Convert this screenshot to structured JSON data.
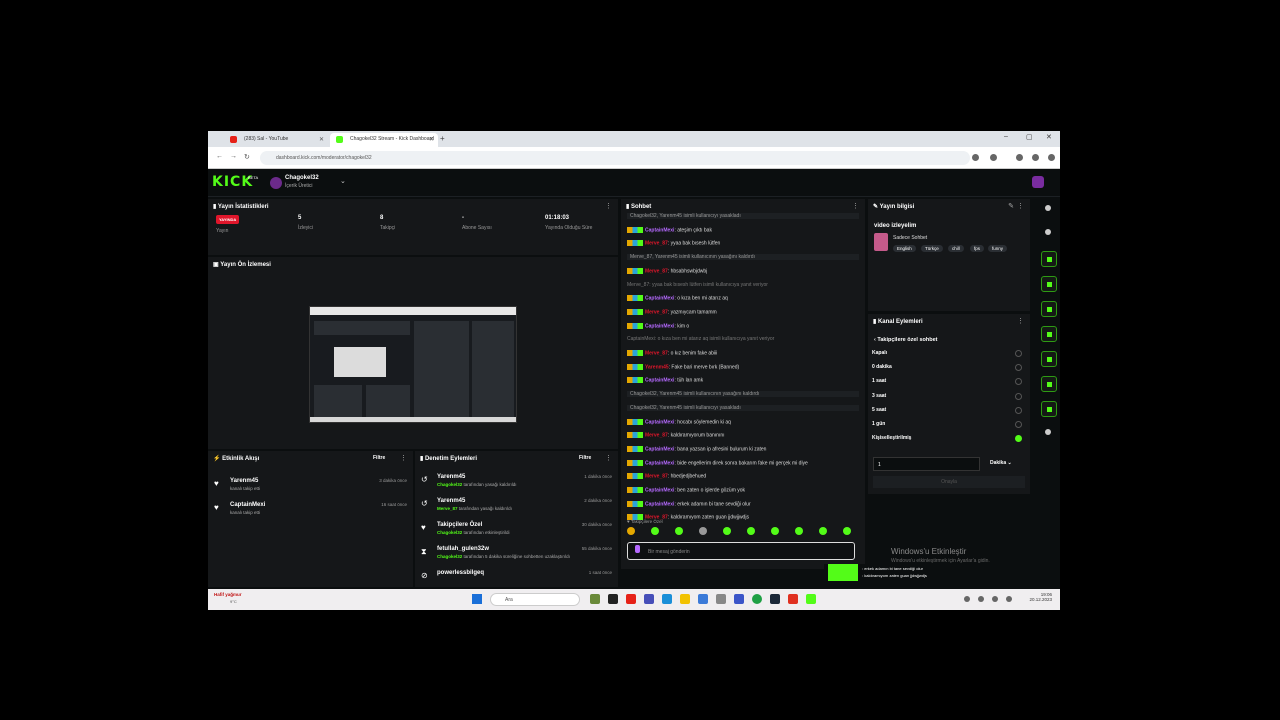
{
  "browser": {
    "tabs": [
      {
        "title": "(283) Sal - YouTube"
      },
      {
        "title": "Chagokel32 Stream - Kick Dashboard"
      }
    ],
    "url": "dashboard.kick.com/moderator/chagokel32"
  },
  "header": {
    "logo": "KICK",
    "beta": "BETA",
    "channel": "Chagokel32",
    "role": "İçerik Üretici"
  },
  "stats": {
    "title": "Yayın İstatistikleri",
    "live_badge": "YAYINDA",
    "items": [
      {
        "label": "Yayın",
        "value": ""
      },
      {
        "label": "İzleyici",
        "value": "5"
      },
      {
        "label": "Takipçi",
        "value": "8"
      },
      {
        "label": "Abone Sayısı",
        "value": "-"
      },
      {
        "label": "Yayında Olduğu Süre",
        "value": "01:18:03"
      }
    ]
  },
  "preview": {
    "title": "Yayın Ön İzlemesi"
  },
  "activity": {
    "title": "Etkinlik Akışı",
    "filter": "Filtre",
    "items": [
      {
        "name": "Yarenm45",
        "desc": "kanalı takip etti",
        "time": "3 dakika önce"
      },
      {
        "name": "CaptainMexi",
        "desc": "kanalı takip etti",
        "time": "16 saat önce"
      }
    ]
  },
  "moderation": {
    "title": "Denetim Eylemleri",
    "filter": "Filtre",
    "items": [
      {
        "name": "Yarenm45",
        "actor": "Chagokel32",
        "desc": "tarafından yasağı kaldırıldı",
        "time": "1 dakika önce"
      },
      {
        "name": "Yarenm45",
        "actor": "Merve_87",
        "desc": "tarafından yasağı kaldırıldı",
        "time": "2 dakika önce"
      },
      {
        "name": "Takipçilere Özel",
        "actor": "Chagokel32",
        "desc": "tarafından etkinleştirildi",
        "time": "30 dakika önce"
      },
      {
        "name": "fetullah_gulen32w",
        "actor": "Chagokel32",
        "desc": "tarafından 5 dakika süreliğine sohbetten uzaklaştırıldı",
        "time": "55 dakika önce"
      },
      {
        "name": "powerlessbilgeq",
        "actor": "",
        "desc": "",
        "time": "1 saat önce"
      }
    ]
  },
  "chat": {
    "title": "Sohbet",
    "followers_only": "Takipçilere Özel",
    "placeholder": "Bir mesaj gönderin",
    "messages": [
      {
        "type": "sys",
        "text": "Chagokel32, Yarenm45 isimli kullanıcıyı yasakladı"
      },
      {
        "type": "msg",
        "user": "CaptainMexi",
        "color": "cap",
        "text": ": ateşim çıktı bak"
      },
      {
        "type": "msg",
        "user": "Merve_87",
        "color": "mer",
        "text": ": yyaa bak bısesh lütfen"
      },
      {
        "type": "sys",
        "text": "Merve_87, Yarenm45 isimli kullanıcının yasağını kaldırdı"
      },
      {
        "type": "msg",
        "user": "Merve_87",
        "color": "mer",
        "text": ": hbsabhswbjdwbj"
      },
      {
        "type": "note",
        "text": "Merve_87: yyaa bak bısesh lütfen isimli kullanıcıya yanıt veriyor"
      },
      {
        "type": "msg",
        "user": "CaptainMexi",
        "color": "cap",
        "text": ": o kıza ben mi atarız aq"
      },
      {
        "type": "msg",
        "user": "Merve_87",
        "color": "mer",
        "text": ": yazmıycam tamamm"
      },
      {
        "type": "msg",
        "user": "CaptainMexi",
        "color": "cap",
        "text": ": kim o"
      },
      {
        "type": "note",
        "text": "CaptainMexi: o kıza ben mi atarız aq isimli kullanıcıya yanıt veriyor"
      },
      {
        "type": "msg",
        "user": "Merve_87",
        "color": "mer",
        "text": ": o kız benim fake abiii"
      },
      {
        "type": "msg",
        "user": "Yarenm45",
        "color": "mer",
        "text": ": Fake bari merve bırk (Banned)"
      },
      {
        "type": "msg",
        "user": "CaptainMexi",
        "color": "cap",
        "text": ": tüh lan amk"
      },
      {
        "type": "sys",
        "text": "Chagokel32, Yarenm45 isimli kullanıcının yasağını kaldırdı"
      },
      {
        "type": "sys",
        "text": "Chagokel32, Yarenm45 isimli kullanıcıyı yasakladı"
      },
      {
        "type": "msg",
        "user": "CaptainMexi",
        "color": "cap",
        "text": ": hocabı söylemedin ki aq"
      },
      {
        "type": "msg",
        "user": "Merve_87",
        "color": "mer",
        "text": ": kaldıramıyorum banınını"
      },
      {
        "type": "msg",
        "user": "CaptainMexi",
        "color": "cap",
        "text": ": bana yazsan ip afresini bulurum ki zaten"
      },
      {
        "type": "msg",
        "user": "CaptainMexi",
        "color": "cap",
        "text": ": bide engellerim direk sonra bakarım fake mi gerçek mi diye"
      },
      {
        "type": "msg",
        "user": "Merve_87",
        "color": "mer",
        "text": ": hbedjedjbehued"
      },
      {
        "type": "msg",
        "user": "CaptainMexi",
        "color": "cap",
        "text": ": ben zaten o işlerde gözüm yok"
      },
      {
        "type": "msg",
        "user": "CaptainMexi",
        "color": "cap",
        "text": ": erkek adamın bi tane sevdiği olur"
      },
      {
        "type": "msg",
        "user": "Merve_87",
        "color": "mer",
        "text": ": kaldıramıyom zaten guan jjdwjjwdjs"
      }
    ]
  },
  "stream_info": {
    "title": "Yayın bilgisi",
    "stream_title": "video izleyelim",
    "category": "Sadece Sohbet",
    "tags": [
      "English",
      "Türkçe",
      "chill",
      "fps",
      "funny"
    ]
  },
  "channel_actions": {
    "title": "Kanal Eylemleri",
    "back": "Takipçilere özel sohbet",
    "options": [
      {
        "label": "Kapalı",
        "selected": false
      },
      {
        "label": "0 dakika",
        "selected": false
      },
      {
        "label": "1 saat",
        "selected": false
      },
      {
        "label": "3 saat",
        "selected": false
      },
      {
        "label": "5 saat",
        "selected": false
      },
      {
        "label": "1 gün",
        "selected": false
      },
      {
        "label": "Kişiselleştirilmiş",
        "selected": true
      }
    ],
    "custom_value": "1",
    "unit": "Dakika",
    "confirm": "Onayla"
  },
  "watermark": {
    "title": "Windows'u Etkinleştir",
    "subtitle": "Windows'u etkinleştirmek için Ayarlar'a gidin."
  },
  "popup": {
    "line1": ": erkek adamın bi tane sevdiği olur",
    "line2": ": kaldıramıyom zaten guan jjdwjjwdjs"
  },
  "taskbar": {
    "weather": "Hafif yağmur",
    "weather_sub": "9°C",
    "search": "Ara",
    "time": "19:06",
    "date": "20.12.2023"
  },
  "colors": {
    "accent": "#53fc18",
    "live": "#e0162b",
    "panel": "#151719"
  }
}
